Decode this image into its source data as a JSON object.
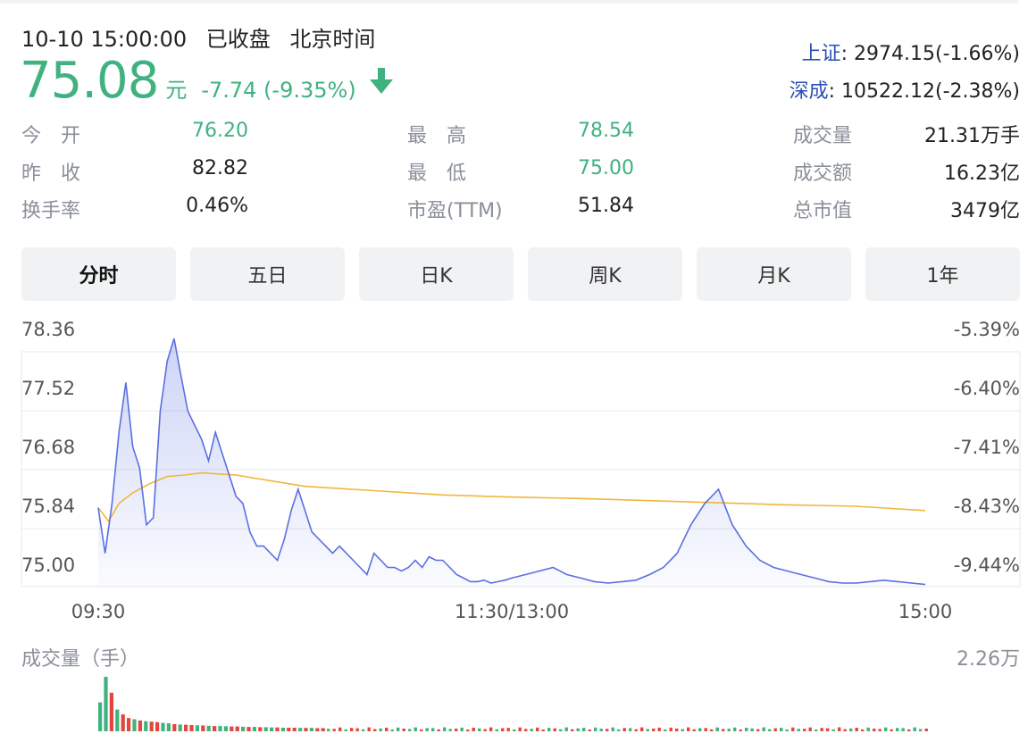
{
  "header": {
    "datetime": "10-10 15:00:00",
    "market_status": "已收盘",
    "timezone": "北京时间",
    "price": "75.08",
    "unit": "元",
    "change": "-7.74 (-9.35%)",
    "trend_icon": "arrow-down-icon",
    "color_down": "#3fb27f"
  },
  "indices": [
    {
      "name": "上证",
      "value": ": 2974.15(-1.66%)"
    },
    {
      "name": "深成",
      "value": ": 10522.12(-2.38%)"
    }
  ],
  "stats": [
    {
      "label": "今　开",
      "value": "76.20",
      "green": true
    },
    {
      "label": "最　高",
      "value": "78.54",
      "green": true
    },
    {
      "label": "成交量",
      "value": "21.31万手",
      "green": false
    },
    {
      "label": "昨　收",
      "value": "82.82",
      "green": false
    },
    {
      "label": "最　低",
      "value": "75.00",
      "green": true
    },
    {
      "label": "成交额",
      "value": "16.23亿",
      "green": false
    },
    {
      "label": "换手率",
      "value": "0.46%",
      "green": false
    },
    {
      "label": "市盈(TTM)",
      "value": "51.84",
      "green": false
    },
    {
      "label": "总市值",
      "value": "3479亿",
      "green": false
    }
  ],
  "tabs": [
    {
      "label": "分时",
      "active": true
    },
    {
      "label": "五日",
      "active": false
    },
    {
      "label": "日K",
      "active": false
    },
    {
      "label": "周K",
      "active": false
    },
    {
      "label": "月K",
      "active": false
    },
    {
      "label": "1年",
      "active": false
    }
  ],
  "volume": {
    "title": "成交量（手）",
    "max_label": "2.26万",
    "up_color": "#e2463c",
    "down_color": "#3fb27f"
  },
  "chart_data": {
    "type": "line",
    "title": "",
    "xlabel": "",
    "ylabel": "",
    "ylim": [
      74.73,
      78.36
    ],
    "y_ticks": [
      "78.36",
      "77.52",
      "76.68",
      "75.84",
      "75.00"
    ],
    "y_tick_values": [
      78.36,
      77.52,
      76.68,
      75.84,
      75.0
    ],
    "pct_ticks": [
      "-5.39%",
      "-6.40%",
      "-7.41%",
      "-8.43%",
      "-9.44%"
    ],
    "x_ticks": [
      "09:30",
      "11:30/13:00",
      "15:00"
    ],
    "x_tick_positions": [
      0,
      120,
      240
    ],
    "x_range": [
      0,
      240
    ],
    "grid": true,
    "series": [
      {
        "role": "price",
        "color": "#5b6fe0",
        "x": [
          0,
          2,
          4,
          6,
          8,
          10,
          12,
          14,
          16,
          18,
          20,
          22,
          24,
          26,
          28,
          30,
          32,
          34,
          36,
          38,
          40,
          42,
          44,
          46,
          48,
          50,
          52,
          54,
          56,
          58,
          60,
          62,
          64,
          66,
          68,
          70,
          72,
          74,
          76,
          78,
          80,
          82,
          84,
          86,
          88,
          90,
          92,
          94,
          96,
          98,
          100,
          102,
          104,
          106,
          108,
          110,
          112,
          114,
          116,
          118,
          120,
          124,
          128,
          132,
          136,
          140,
          144,
          148,
          152,
          156,
          160,
          164,
          168,
          172,
          176,
          180,
          184,
          188,
          190,
          192,
          196,
          200,
          204,
          208,
          212,
          216,
          220,
          224,
          228,
          232,
          236,
          240
        ],
        "y": [
          75.84,
          75.2,
          75.9,
          76.9,
          77.6,
          76.7,
          76.4,
          75.6,
          75.7,
          77.2,
          77.9,
          78.22,
          77.7,
          77.2,
          77.0,
          76.8,
          76.5,
          76.9,
          76.6,
          76.3,
          76.0,
          75.9,
          75.5,
          75.3,
          75.3,
          75.2,
          75.1,
          75.4,
          75.8,
          76.1,
          75.8,
          75.5,
          75.4,
          75.3,
          75.2,
          75.3,
          75.2,
          75.1,
          75.0,
          74.9,
          75.2,
          75.1,
          75.0,
          75.0,
          74.95,
          75.0,
          75.1,
          75.0,
          75.15,
          75.1,
          75.1,
          75.0,
          74.9,
          74.85,
          74.8,
          74.8,
          74.82,
          74.78,
          74.8,
          74.82,
          74.85,
          74.9,
          74.95,
          75.0,
          74.9,
          74.85,
          74.8,
          74.78,
          74.8,
          74.82,
          74.9,
          75.0,
          75.2,
          75.6,
          75.9,
          76.1,
          75.6,
          75.3,
          75.2,
          75.1,
          75.0,
          74.95,
          74.9,
          74.85,
          74.8,
          74.78,
          74.78,
          74.8,
          74.82,
          74.8,
          74.78,
          74.76
        ],
        "note_y_unit": "元"
      },
      {
        "role": "average",
        "color": "#f2b63a",
        "x": [
          0,
          3,
          6,
          10,
          15,
          20,
          25,
          30,
          40,
          50,
          60,
          80,
          100,
          120,
          140,
          160,
          180,
          200,
          220,
          240
        ],
        "y": [
          75.84,
          75.65,
          75.9,
          76.05,
          76.18,
          76.28,
          76.3,
          76.33,
          76.3,
          76.22,
          76.14,
          76.08,
          76.02,
          75.99,
          75.97,
          75.94,
          75.91,
          75.88,
          75.86,
          75.8
        ]
      }
    ],
    "volume_series": {
      "up": [
        0,
        0,
        1,
        0,
        1,
        1,
        0,
        1,
        0,
        1,
        1,
        0,
        0,
        1,
        0,
        1,
        1,
        0,
        1,
        0,
        1,
        0,
        0,
        1,
        1,
        0,
        1,
        0,
        1,
        0,
        0,
        1,
        0,
        1,
        1,
        0,
        1,
        0,
        1,
        1
      ],
      "values": [
        1.2,
        2.26,
        1.6,
        0.9,
        0.7,
        0.55,
        0.5,
        0.45,
        0.42,
        0.4,
        0.38,
        0.35,
        0.33,
        0.3,
        0.28,
        0.27,
        0.26,
        0.25,
        0.24,
        0.23,
        0.22,
        0.22,
        0.21,
        0.2,
        0.2,
        0.19,
        0.18,
        0.18,
        0.17,
        0.17,
        0.16,
        0.16,
        0.15,
        0.15,
        0.15,
        0.14,
        0.14,
        0.14,
        0.13,
        0.13
      ],
      "unit": "万"
    }
  }
}
